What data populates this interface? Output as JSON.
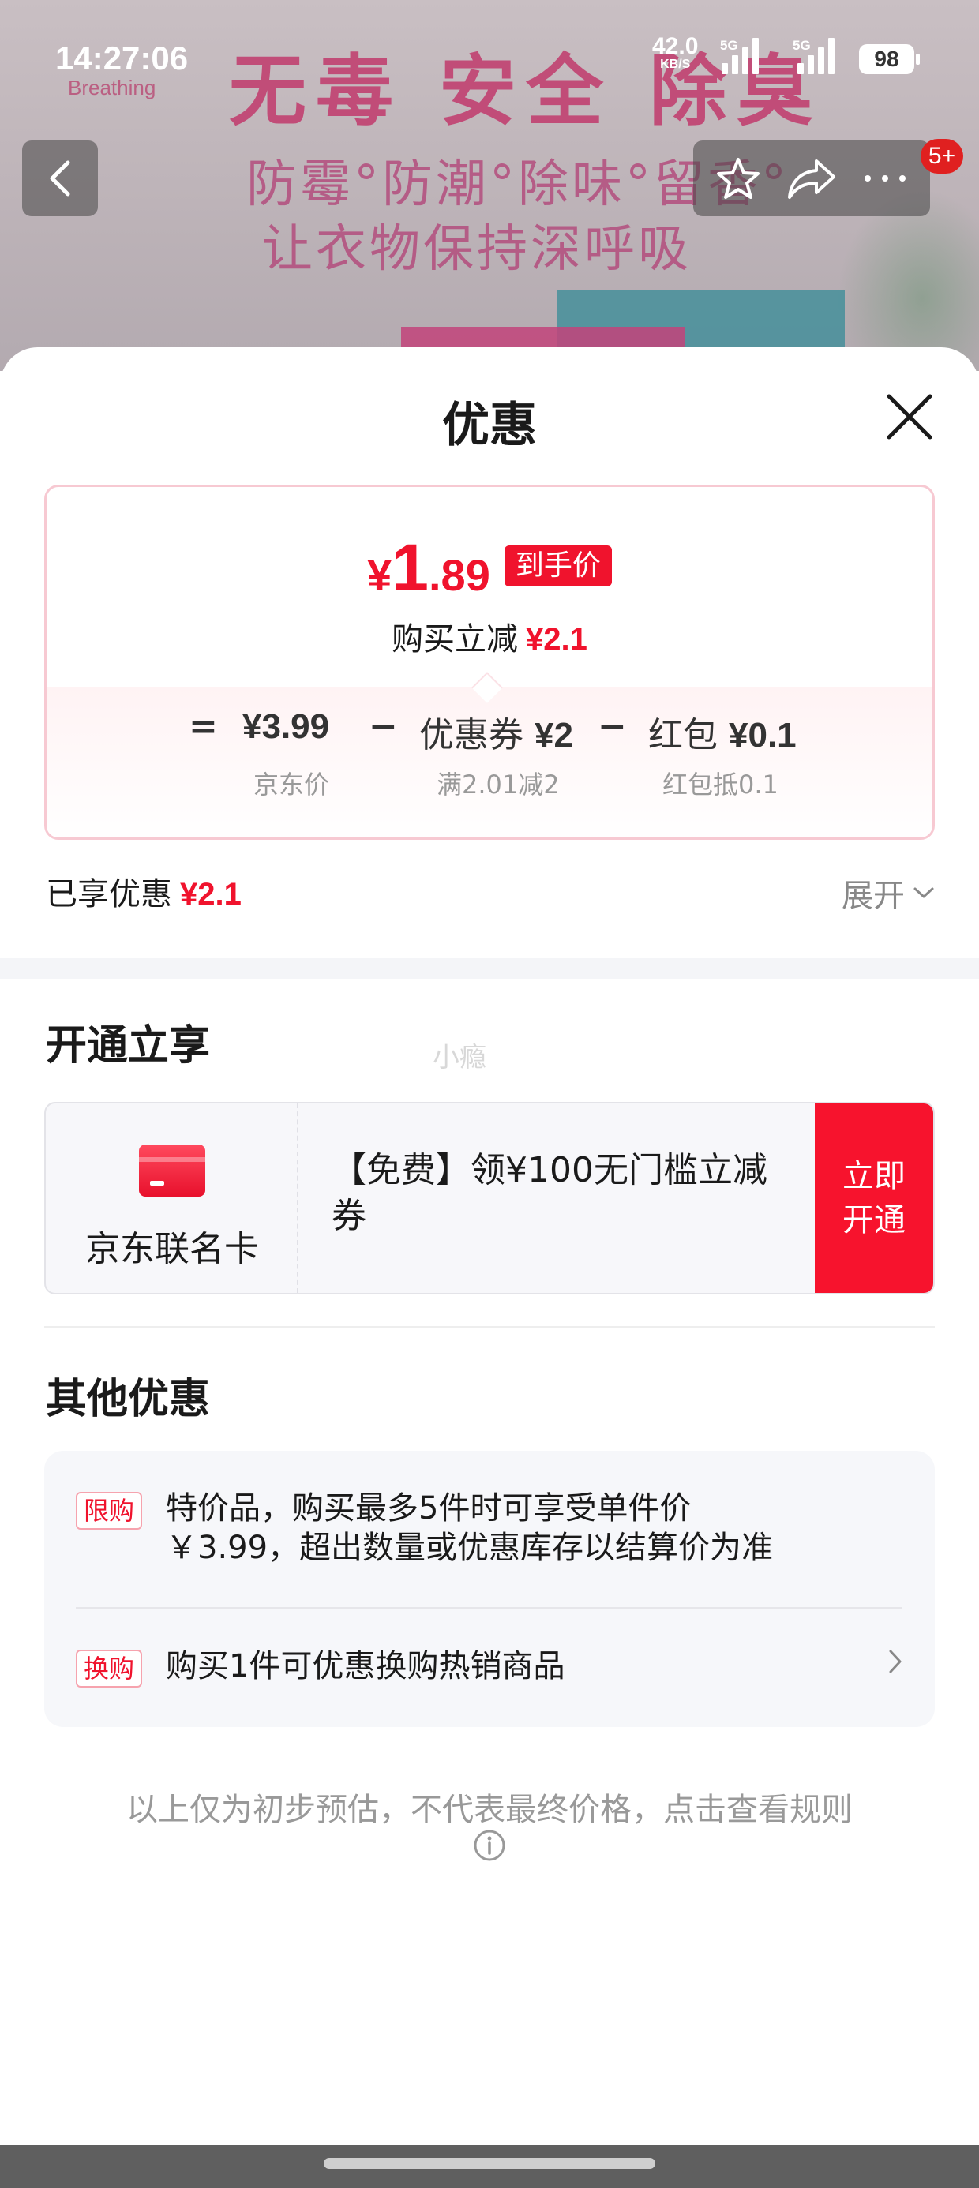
{
  "status_bar": {
    "time": "14:27:06",
    "net_speed": "42.0",
    "net_unit": "KB/S",
    "sim1_tag": "5G",
    "sim2_tag": "5G",
    "battery": "98"
  },
  "background": {
    "headline": "无毒 安全 除臭",
    "brand": "Breathing",
    "line1": "防霉°防潮°除味°留香°",
    "line2": "让衣物保持深呼吸"
  },
  "nav": {
    "message_badge": "5+",
    "icons": [
      "chevron-left-icon",
      "star-icon",
      "share-icon",
      "more-icon"
    ]
  },
  "sheet": {
    "title": "优惠",
    "price": {
      "currency": "¥",
      "integer": "1",
      "decimal": ".89",
      "tag": "到手价",
      "instant_label": "购买立减",
      "instant_amount": "¥2.1"
    },
    "formula": {
      "equals": "=",
      "minus": "−",
      "jd_price": "¥3.99",
      "jd_price_label": "京东价",
      "coupon_label": "优惠券",
      "coupon_value": "¥2",
      "coupon_desc": "满2.01减2",
      "redpacket_label": "红包",
      "redpacket_value": "¥0.1",
      "redpacket_desc": "红包抵0.1"
    },
    "enjoyed_label": "已享优惠",
    "enjoyed_amount": "¥2.1",
    "expand_label": "展开",
    "open_section_title": "开通立享",
    "watermark": "小瘾",
    "card_offer": {
      "name": "京东联名卡",
      "desc": "【免费】领¥100无门槛立减券",
      "cta": "立即开通"
    },
    "other_section_title": "其他优惠",
    "other_offers": [
      {
        "tag": "限购",
        "text_line1": "特价品，购买最多5件时可享受单件价",
        "text_line2": "￥3.99，超出数量或优惠库存以结算价为准"
      },
      {
        "tag": "换购",
        "text_line1": "购买1件可优惠换购热销商品"
      }
    ],
    "footer_note": "以上仅为初步预估，不代表最终价格，点击查看规则"
  },
  "colors": {
    "accent_red": "#f0132d",
    "card_border": "#f7c9d2",
    "muted_text": "#999999"
  }
}
